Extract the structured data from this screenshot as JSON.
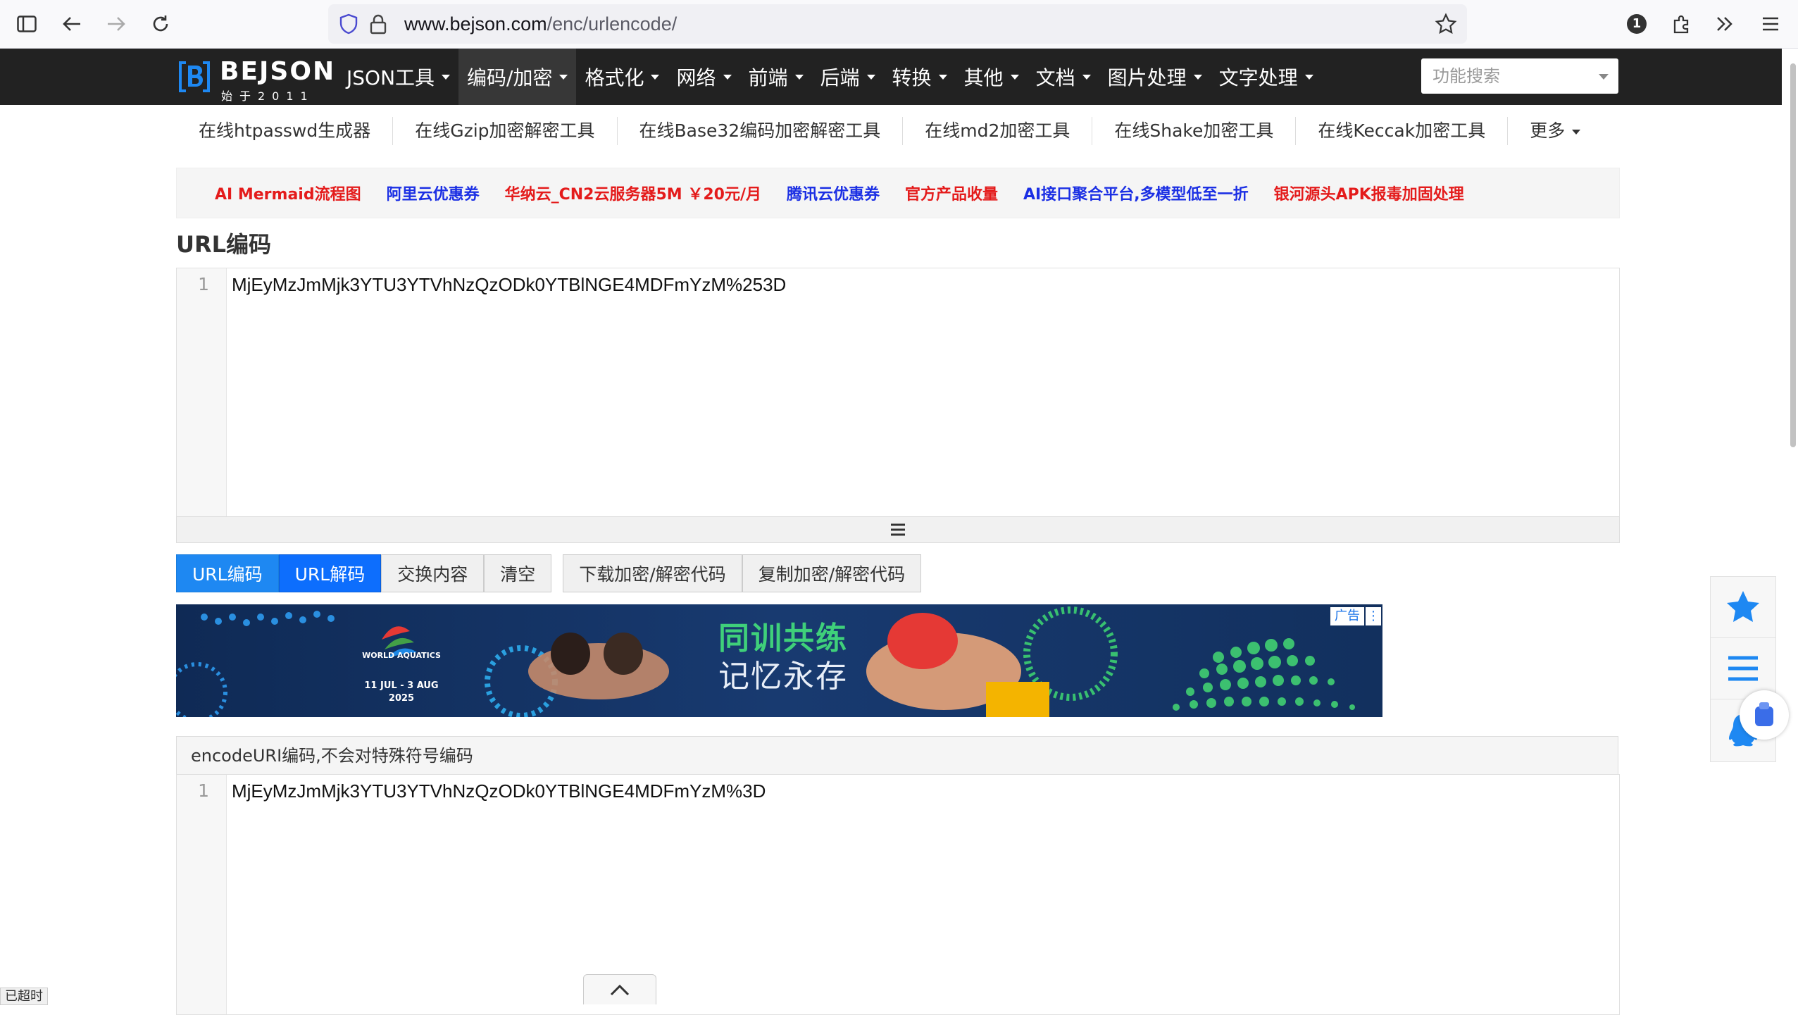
{
  "browser": {
    "url_host": "www.bejson.com",
    "url_path": "/enc/urlencode/",
    "extension_badge": "1"
  },
  "logo": {
    "title": "BEJSON",
    "subtitle": "始于2011"
  },
  "nav": {
    "items": [
      {
        "label": "JSON工具"
      },
      {
        "label": "编码/加密"
      },
      {
        "label": "格式化"
      },
      {
        "label": "网络"
      },
      {
        "label": "前端"
      },
      {
        "label": "后端"
      },
      {
        "label": "转换"
      },
      {
        "label": "其他"
      },
      {
        "label": "文档"
      },
      {
        "label": "图片处理"
      },
      {
        "label": "文字处理"
      }
    ],
    "search_placeholder": "功能搜索"
  },
  "subnav": {
    "items": [
      "在线htpasswd生成器",
      "在线Gzip加密解密工具",
      "在线Base32编码加密解密工具",
      "在线md2加密工具",
      "在线Shake加密工具",
      "在线Keccak加密工具",
      "更多"
    ]
  },
  "ad_links": [
    {
      "text": "AI Mermaid流程图",
      "color": "#e41b1b"
    },
    {
      "text": "阿里云优惠券",
      "color": "#1b2fe4"
    },
    {
      "text": "华纳云_CN2云服务器5M ￥20元/月",
      "color": "#e41b1b"
    },
    {
      "text": "腾讯云优惠券",
      "color": "#1b2fe4"
    },
    {
      "text": "官方产品收量",
      "color": "#e41b1b"
    },
    {
      "text": "AI接口聚合平台,多模型低至一折",
      "color": "#1b2fe4"
    },
    {
      "text": "银河源头APK报毒加固处理",
      "color": "#e41b1b"
    }
  ],
  "page_title": "URL编码",
  "input_editor": {
    "line": "1",
    "text": "MjEyMzJmMjk3YTU3YTVhNzQzODk0YTBlNGE4MDFmYzM%253D"
  },
  "buttons": {
    "encode": "URL编码",
    "decode": "URL解码",
    "swap": "交换内容",
    "clear": "清空",
    "download": "下载加密/解密代码",
    "copy": "复制加密/解密代码"
  },
  "banner": {
    "headline1": "同训共练",
    "headline2": "记忆永存",
    "event_name": "WORLD AQUATICS",
    "event_dates": "11 JUL - 3 AUG",
    "event_year": "2025",
    "ad_label": "广告"
  },
  "output_panel": {
    "title": "encodeURI编码,不会对特殊符号编码",
    "line": "1",
    "text": "MjEyMzJmMjk3YTU3YTVhNzQzODk0YTBlNGE4MDFmYzM%3D"
  },
  "status_text": "已超时",
  "colors": {
    "nav_bg": "#222222",
    "primary": "#1e88f2",
    "logo_blue": "#1e88f2"
  }
}
